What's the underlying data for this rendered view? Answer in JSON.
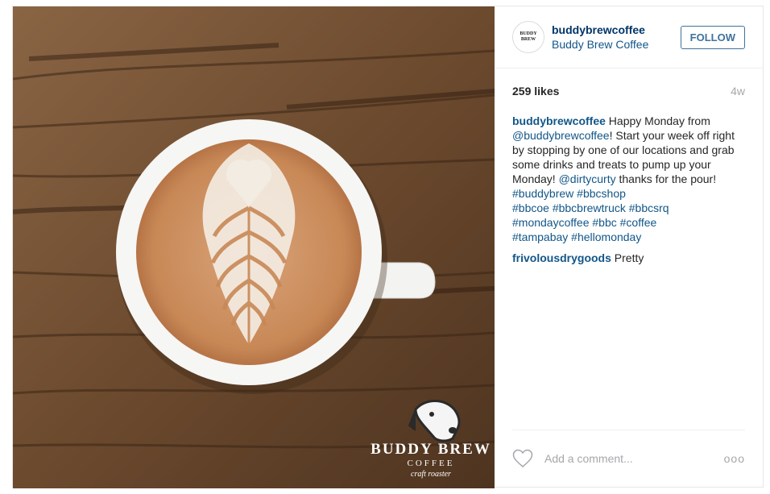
{
  "post": {
    "username": "buddybrewcoffee",
    "full_name": "Buddy Brew Coffee",
    "follow_label": "FOLLOW",
    "likes": "259 likes",
    "age": "4w",
    "avatar_text": "BUDDY BREW",
    "photo_logo": {
      "line1": "BUDDY BREW",
      "line2": "COFFEE",
      "line3": "craft roaster"
    }
  },
  "caption": {
    "author": "buddybrewcoffee",
    "text_1": " Happy Monday from ",
    "mention_1": "@buddybrewcoffee",
    "text_2": "! Start your week off right by stopping by one of our locations and grab some drinks and treats to pump up your Monday! ",
    "mention_2": "@dirtycurty",
    "text_3": " thanks for the pour!",
    "hashtags": [
      "#buddybrew",
      "#bbcshop",
      "#bbcoe",
      "#bbcbrewtruck",
      "#bbcsrq",
      "#mondaycoffee",
      "#bbc",
      "#coffee",
      "#tampabay",
      "#hellomonday"
    ]
  },
  "comments": [
    {
      "author": "frivolousdrygoods",
      "text": " Pretty"
    }
  ],
  "footer": {
    "add_comment_placeholder": "Add a comment...",
    "more_label": "ooo"
  },
  "icons": {
    "like": "heart-icon",
    "options": "more-options-icon",
    "logo": "dog-logo-icon"
  }
}
